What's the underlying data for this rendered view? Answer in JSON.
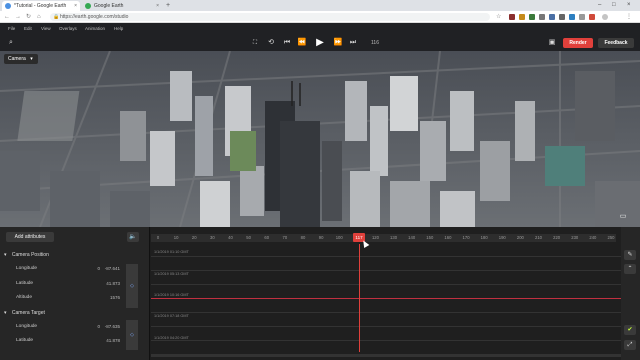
{
  "browser": {
    "tabs": [
      {
        "label": "*Tutorial - Google Earth Studio",
        "fav_color": "#4a90e2"
      },
      {
        "label": "Google Earth",
        "fav_color": "#34a853"
      }
    ],
    "new_tab": "+",
    "window": {
      "minimize": "–",
      "maximize": "□",
      "close": "×"
    },
    "nav": {
      "back": "←",
      "forward": "→",
      "reload": "↻",
      "home": "⌂"
    },
    "url": "https://earth.google.com/studio",
    "lock": "🔒",
    "star": "☆",
    "menu_dots": "⋮"
  },
  "app": {
    "menu": [
      "File",
      "Edit",
      "View",
      "Overlays",
      "Animation",
      "Help"
    ],
    "search_icon": "⌕",
    "transport": {
      "fit": "⛶",
      "loop": "⟲",
      "first": "⏮",
      "prev": "⏪",
      "play": "▶",
      "next": "⏩",
      "last": "⏭"
    },
    "frame": "116",
    "render_label": "Render",
    "feedback_label": "Feedback",
    "image_icon": "▣",
    "render_color": "#e0403b",
    "feedback_color": "#3a3a3a"
  },
  "viewport": {
    "camera_tag": "Camera",
    "camera_chevron": "▾",
    "screen_icon": "▭"
  },
  "panel": {
    "add_attributes": "Add attributes",
    "speaker": "🔈",
    "groups": [
      {
        "label": "Camera Position",
        "attrs": [
          {
            "name": "Longitude",
            "value": "-87.641"
          },
          {
            "name": "Latitude",
            "value": "41.873"
          },
          {
            "name": "Altitude",
            "value": "1576"
          }
        ]
      },
      {
        "label": "Camera Target",
        "attrs": [
          {
            "name": "Longitude",
            "value": "-87.635"
          },
          {
            "name": "Latitude",
            "value": "41.878"
          }
        ]
      }
    ],
    "key_marker": "◇",
    "chevron": "▾",
    "value_prefix": "0"
  },
  "timeline": {
    "ticks": [
      "0",
      "10",
      "20",
      "30",
      "40",
      "50",
      "60",
      "70",
      "80",
      "90",
      "100",
      "110",
      "120",
      "130",
      "140",
      "150",
      "160",
      "170",
      "180",
      "190",
      "200",
      "210",
      "220",
      "230",
      "240",
      "250"
    ],
    "playhead_label": "117",
    "timestamps": [
      "1/1/2019 01:10 GMT",
      "1/1/2019 05:13 GMT",
      "1/1/2019 10:16 GMT",
      "1/1/2019 07:18 GMT",
      "1/1/2019 04:20 GMT"
    ],
    "right_buttons": [
      "✎",
      "⌃",
      "✔",
      "⤢"
    ]
  }
}
